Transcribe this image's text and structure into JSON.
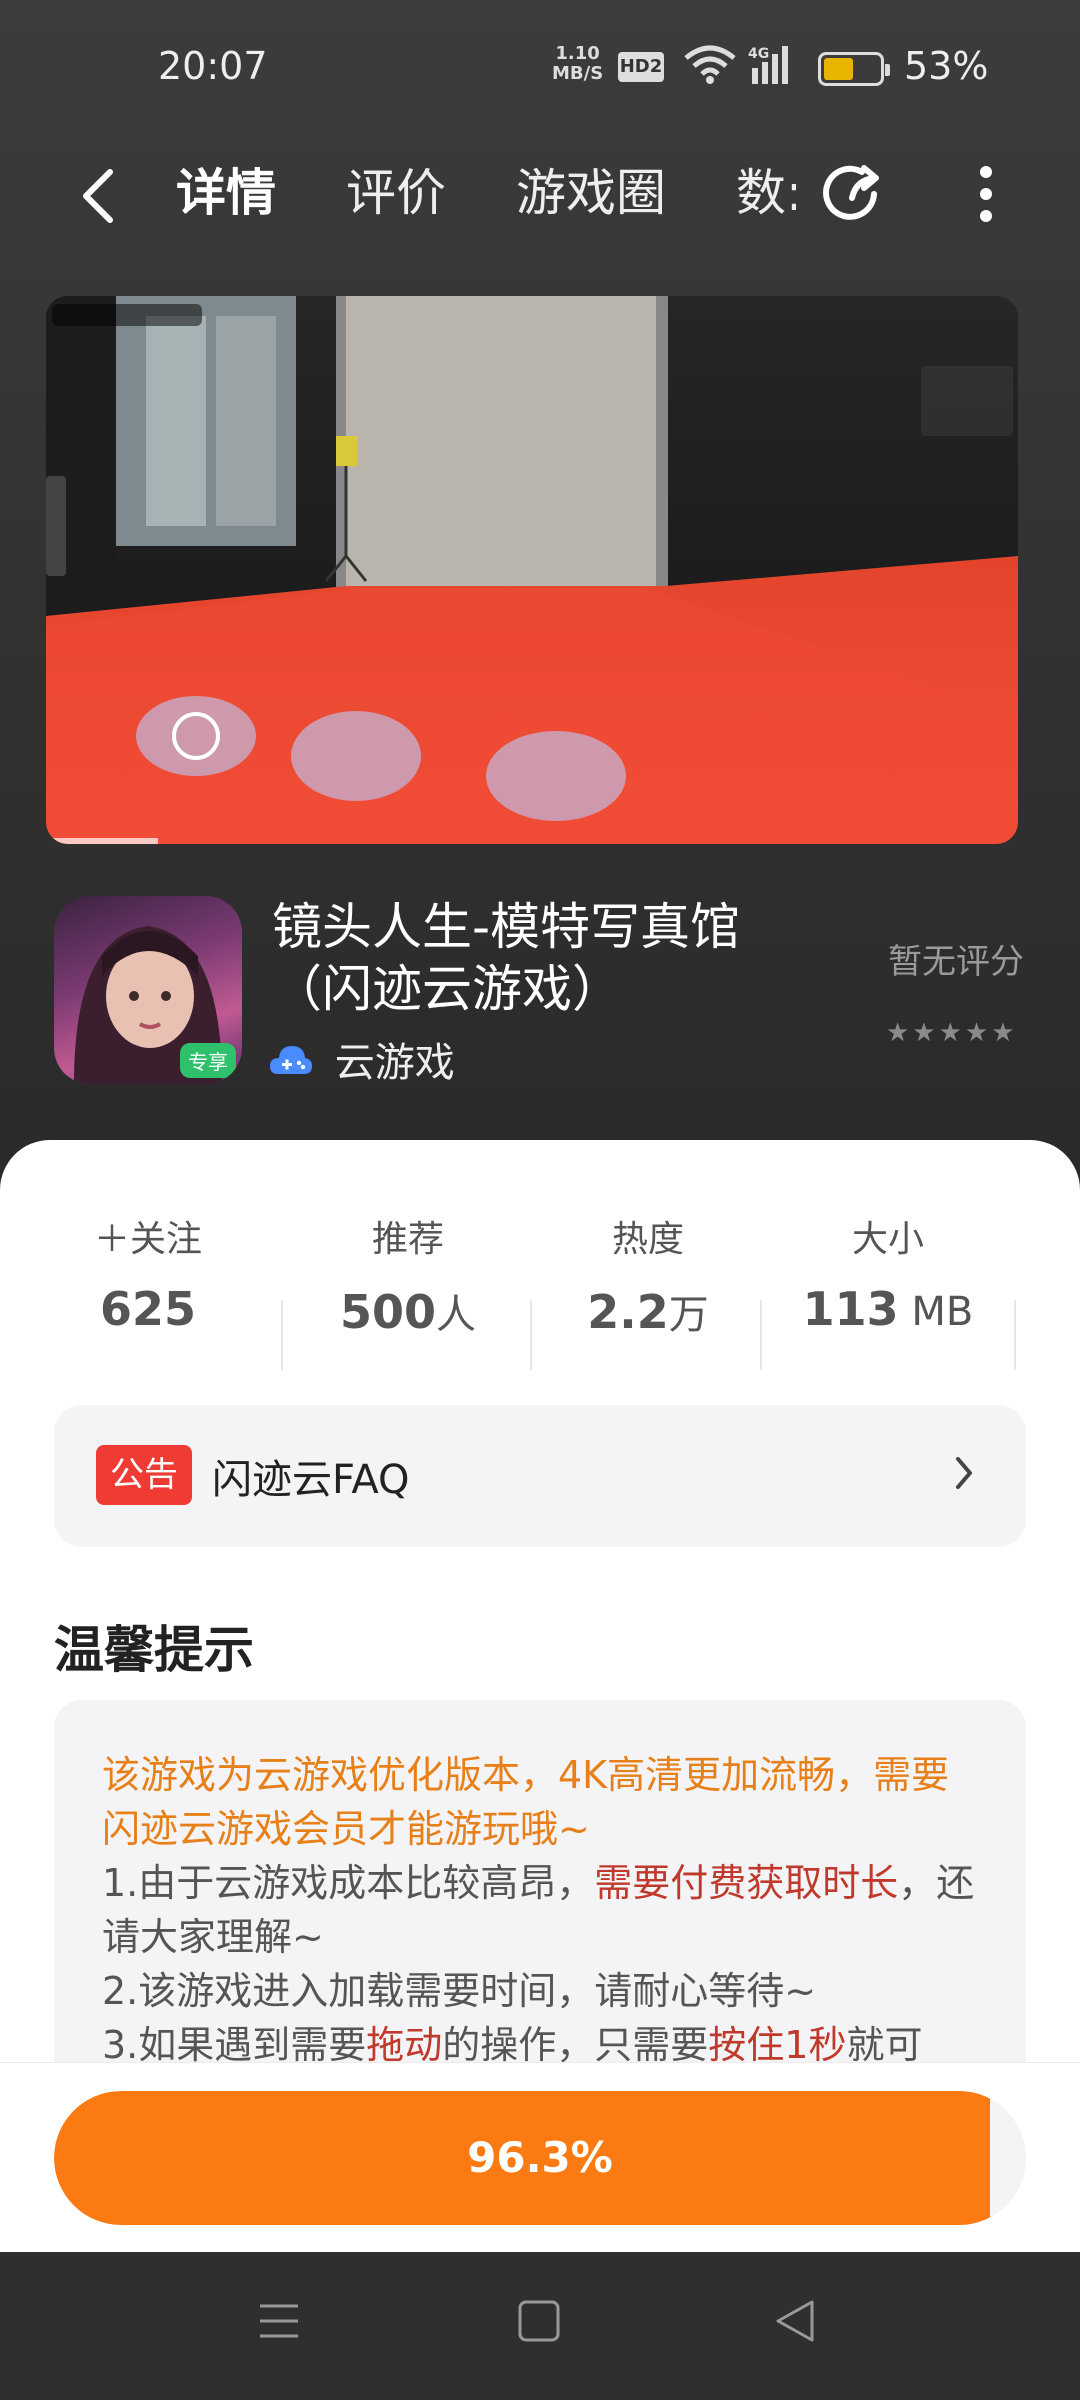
{
  "status_bar": {
    "time": "20:07",
    "net_speed_value": "1.10",
    "net_speed_unit": "MB/S",
    "hd_label": "HD2",
    "signal_label": "4G",
    "battery_text": "53%",
    "battery_level": 0.53,
    "battery_color": "#e8b400"
  },
  "nav": {
    "tabs": [
      {
        "label": "详情",
        "active": true
      },
      {
        "label": "评价",
        "active": false
      },
      {
        "label": "游戏圈",
        "active": false
      },
      {
        "label": "数:",
        "active": false
      }
    ]
  },
  "game": {
    "title": "镜头人生-模特写真馆（闪迹云游戏）",
    "cloud_label": "云游戏",
    "icon_badge": "专享",
    "rating_text": "暂无评分",
    "stars": "★★★★★"
  },
  "stats": [
    {
      "label": "＋关注",
      "value": "625",
      "unit": ""
    },
    {
      "label": "推荐",
      "value": "500",
      "unit": "人"
    },
    {
      "label": "热度",
      "value": "2.2",
      "unit": "万"
    },
    {
      "label": "大小",
      "value": "113",
      "unit": " MB"
    }
  ],
  "notice": {
    "tag": "公告",
    "text": "闪迹云FAQ"
  },
  "tips": {
    "title": "温馨提示",
    "line1": "该游戏为云游戏优化版本，4K高清更加流畅，需要闪迹云游戏会员才能游玩哦~",
    "line2_a": "1.由于云游戏成本比较高昂，",
    "line2_b": "需要付费获取时长",
    "line2_c": "，还请大家理解~",
    "line3": "2.该游戏进入加载需要时间，请耐心等待~",
    "line4_a": "3.如果遇到需要",
    "line4_b": "拖动",
    "line4_c": "的操作，只需要",
    "line4_d": "按住1秒",
    "line4_e": "就可"
  },
  "download": {
    "text": "96.3%",
    "progress": 0.963,
    "color": "#fb7a12"
  },
  "colors": {
    "accent": "#fb7a12",
    "notice_red": "#ef3b33",
    "tip_orange": "#e8801a",
    "tip_red": "#c0392b"
  }
}
